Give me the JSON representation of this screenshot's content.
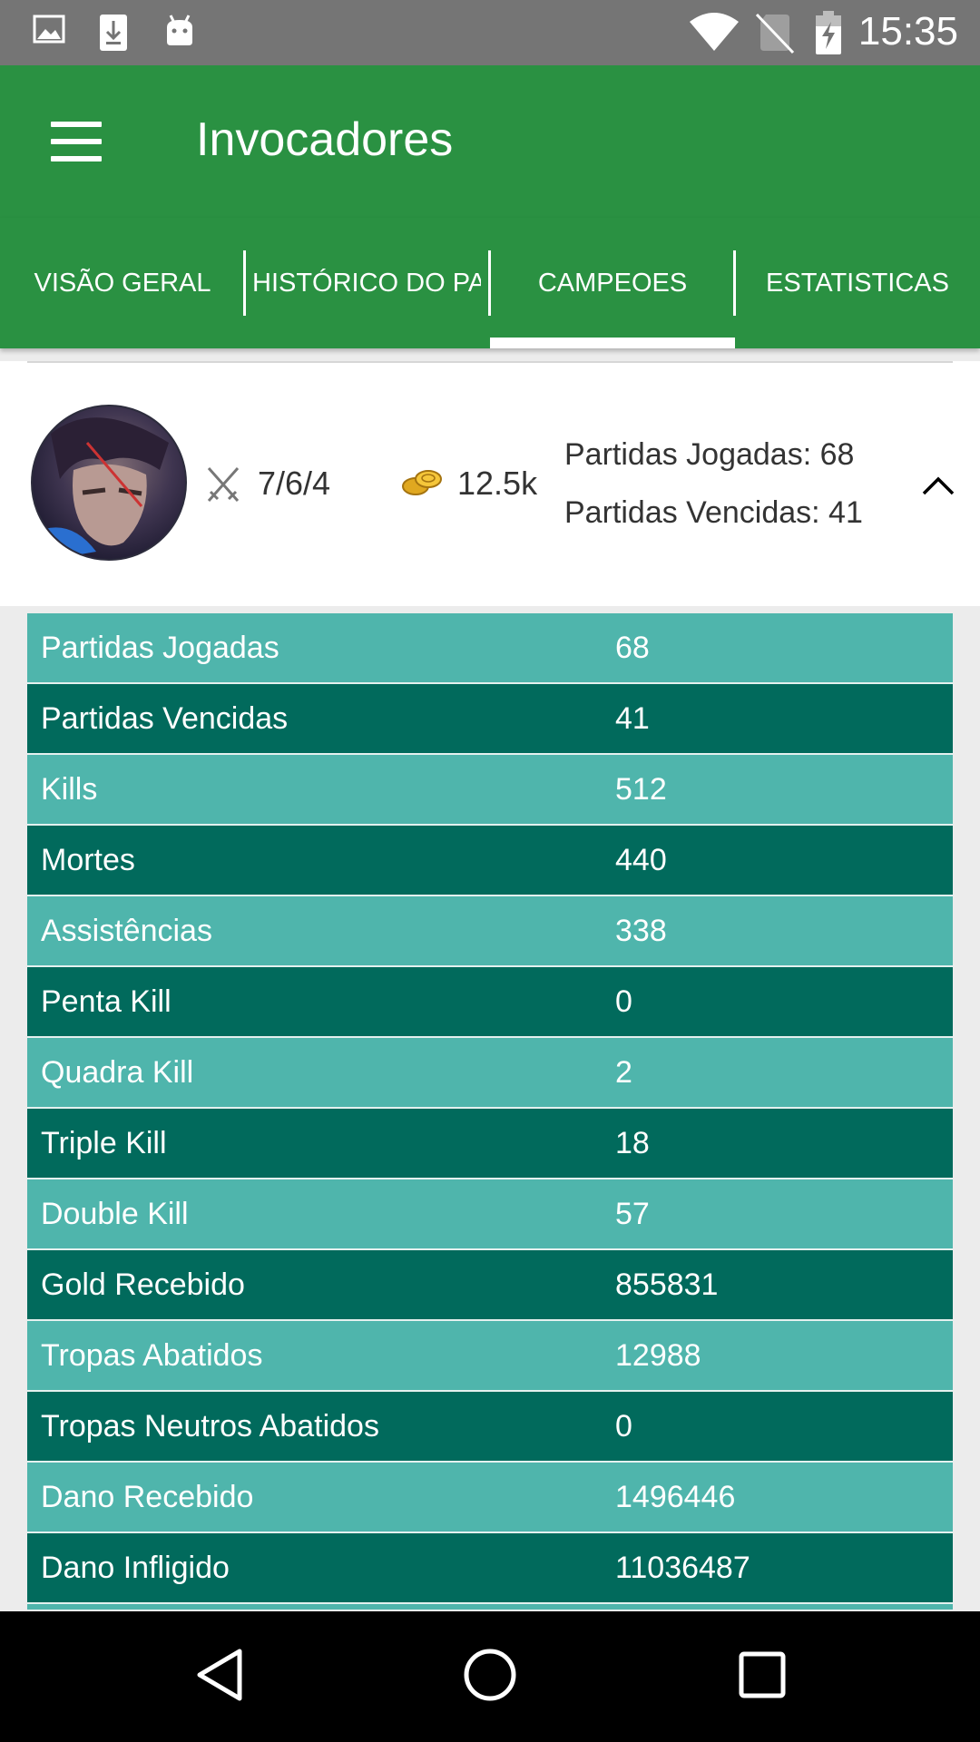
{
  "status_bar": {
    "time": "15:35",
    "left_icons": [
      "image-icon",
      "download-icon",
      "android-icon"
    ],
    "right_icons": [
      "wifi-icon",
      "no-sim-icon",
      "battery-charging-icon"
    ]
  },
  "app_bar": {
    "title": "Invocadores",
    "menu_icon": "hamburger-menu-icon",
    "background": "#2a9142"
  },
  "tabs": [
    {
      "label": "VISÃO GERAL",
      "selected": false
    },
    {
      "label": "HISTÓRICO DO PA",
      "selected": false
    },
    {
      "label": "CAMPEOES",
      "selected": true
    },
    {
      "label": "ESTATISTICAS",
      "selected": false
    }
  ],
  "champion_card": {
    "avatar": "champion-portrait",
    "kda": "7/6/4",
    "kda_icon": "crossed-swords-icon",
    "gold": "12.5k",
    "gold_icon": "gold-coins-icon",
    "played": "Partidas Jogadas: 68",
    "won": "Partidas Vencidas: 41",
    "toggle_icon": "chevron-up-icon"
  },
  "stats": [
    {
      "label": "Partidas Jogadas",
      "value": "68"
    },
    {
      "label": "Partidas Vencidas",
      "value": "41"
    },
    {
      "label": "Kills",
      "value": "512"
    },
    {
      "label": "Mortes",
      "value": "440"
    },
    {
      "label": "Assistências",
      "value": "338"
    },
    {
      "label": "Penta Kill",
      "value": "0"
    },
    {
      "label": "Quadra Kill",
      "value": "2"
    },
    {
      "label": "Triple Kill",
      "value": "18"
    },
    {
      "label": "Double Kill",
      "value": "57"
    },
    {
      "label": "Gold Recebido",
      "value": "855831"
    },
    {
      "label": "Tropas Abatidos",
      "value": "12988"
    },
    {
      "label": "Tropas Neutros Abatidos",
      "value": "0"
    },
    {
      "label": "Dano Recebido",
      "value": "1496446"
    },
    {
      "label": "Dano Infligido",
      "value": "11036487"
    },
    {
      "label": "",
      "value": ""
    }
  ],
  "colors": {
    "row_light": "#4fb5ac",
    "row_dark": "#016a5c",
    "accent": "#2a9142"
  },
  "nav_bar": [
    "back-icon",
    "home-icon",
    "recents-icon"
  ]
}
